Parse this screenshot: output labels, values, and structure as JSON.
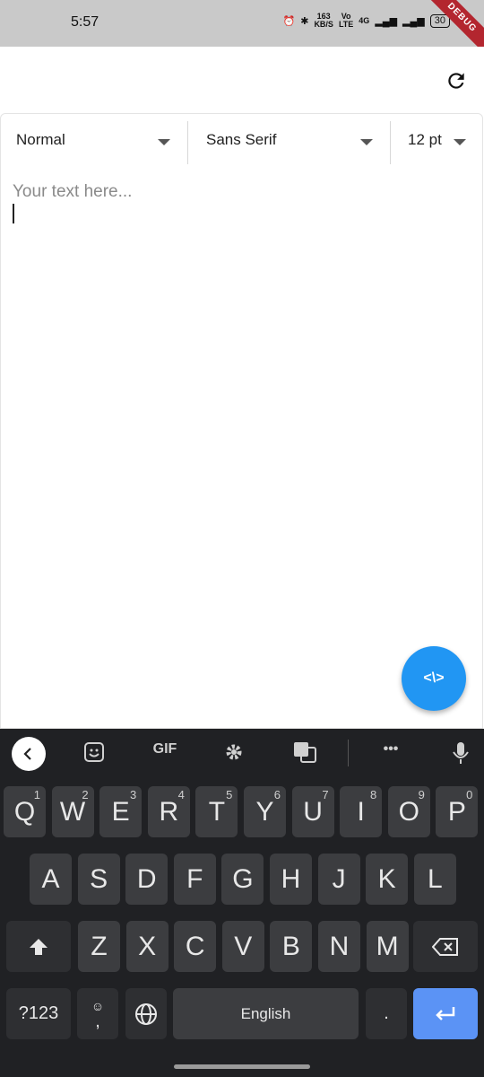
{
  "status_bar": {
    "time": "5:57",
    "speed_top": "163",
    "speed_bottom": "KB/S",
    "volte_top": "Vo",
    "volte_bottom": "LTE",
    "network": "4G",
    "battery": "30",
    "debug_label": "DEBUG"
  },
  "appbar": {
    "refresh_icon": "refresh-icon"
  },
  "toolbar": {
    "style_value": "Normal",
    "font_value": "Sans Serif",
    "size_value": "12 pt"
  },
  "editor": {
    "placeholder": "Your text here..."
  },
  "fab": {
    "label": "<\\>"
  },
  "keyboard": {
    "top_gif": "GIF",
    "row1": [
      {
        "letter": "Q",
        "num": "1"
      },
      {
        "letter": "W",
        "num": "2"
      },
      {
        "letter": "E",
        "num": "3"
      },
      {
        "letter": "R",
        "num": "4"
      },
      {
        "letter": "T",
        "num": "5"
      },
      {
        "letter": "Y",
        "num": "6"
      },
      {
        "letter": "U",
        "num": "7"
      },
      {
        "letter": "I",
        "num": "8"
      },
      {
        "letter": "O",
        "num": "9"
      },
      {
        "letter": "P",
        "num": "0"
      }
    ],
    "row2": [
      "A",
      "S",
      "D",
      "F",
      "G",
      "H",
      "J",
      "K",
      "L"
    ],
    "row3": [
      "Z",
      "X",
      "C",
      "V",
      "B",
      "N",
      "M"
    ],
    "symbols_label": "?123",
    "comma_label": ",",
    "space_label": "English",
    "period_label": "."
  },
  "colors": {
    "accent": "#2196f3",
    "enter": "#5b93f5",
    "keyboard_bg": "#202124",
    "key_bg": "#3c3d40"
  }
}
